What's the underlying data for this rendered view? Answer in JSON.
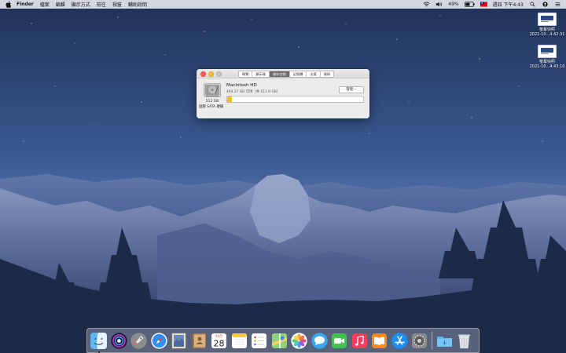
{
  "menubar": {
    "app_name": "Finder",
    "menus": [
      "檔案",
      "編輯",
      "顯示方式",
      "前往",
      "視窗",
      "輔助說明"
    ],
    "battery": "49%",
    "clock": "週四 下午4:43"
  },
  "desktop": {
    "icons": [
      {
        "title": "螢幕快照",
        "subtitle": "2021-10...4.42.31"
      },
      {
        "title": "螢幕快照",
        "subtitle": "2021-10...4.43.10"
      }
    ]
  },
  "window": {
    "tabs": [
      {
        "label": "概覽",
        "active": false
      },
      {
        "label": "顯示器",
        "active": false
      },
      {
        "label": "儲存空間",
        "active": true
      },
      {
        "label": "記憶體",
        "active": false
      },
      {
        "label": "支援",
        "active": false
      },
      {
        "label": "服務",
        "active": false
      }
    ],
    "disk": {
      "name": "Macintosh HD",
      "free_text": "494.37 GB 可用（共 511.9 GB）",
      "size": "512 GB",
      "kind": "固態 SATA 硬碟",
      "used_fraction": 0.034
    },
    "manage_label": "管理⋯"
  },
  "dock": {
    "apps": [
      "finder",
      "siri",
      "launchpad",
      "safari",
      "mail",
      "contacts",
      "calendar",
      "notes",
      "reminders",
      "maps",
      "photos",
      "messages",
      "facetime",
      "music",
      "books",
      "app-store",
      "system-preferences"
    ],
    "calendar_day": "28",
    "calendar_month": "10月",
    "running": [
      "finder"
    ],
    "right_items": [
      "downloads-folder",
      "trash"
    ]
  },
  "colors": {
    "accent_yellow": "#f2c31a",
    "sky_top": "#1f3157",
    "sky_bottom": "#6d86bb"
  }
}
